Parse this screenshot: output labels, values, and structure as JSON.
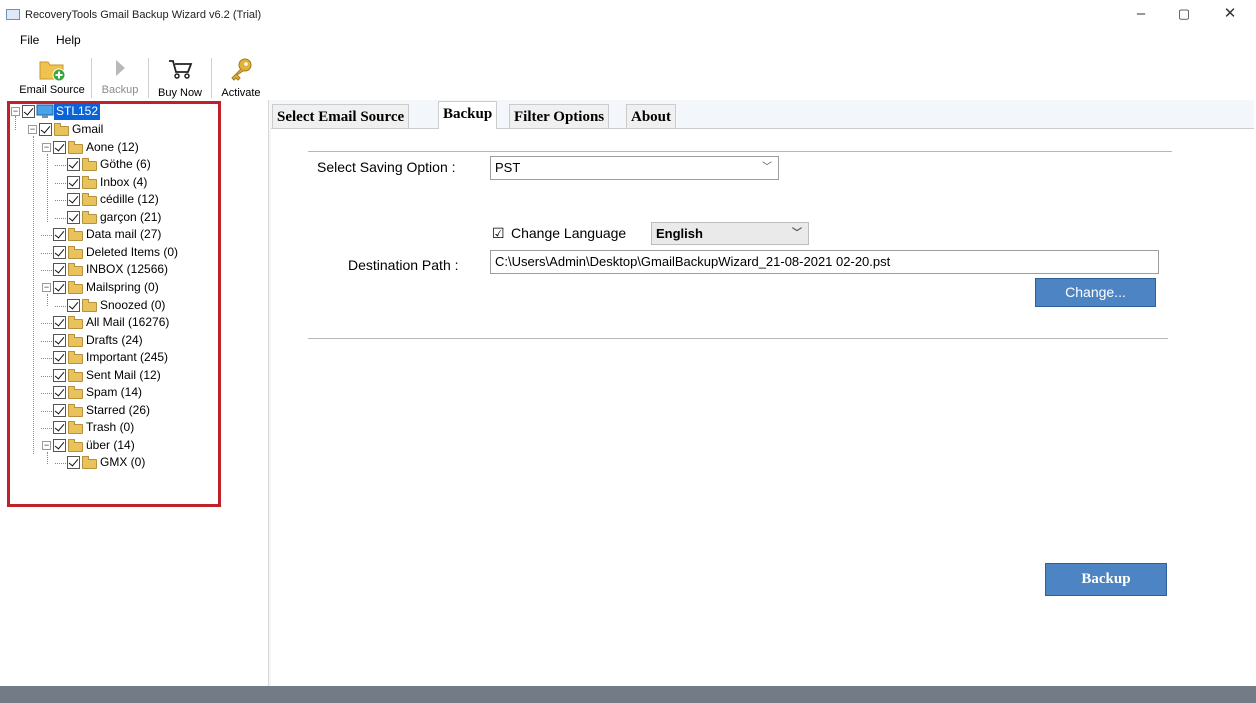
{
  "window": {
    "title": "RecoveryTools Gmail Backup Wizard v6.2 (Trial)",
    "minimize": "–",
    "restore": "▢",
    "close": "✕"
  },
  "menu": [
    "File",
    "Help"
  ],
  "toolbar": {
    "email_source": "Email Source",
    "backup": "Backup",
    "buy_now": "Buy Now",
    "activate": "Activate"
  },
  "tree": {
    "root": "STL152",
    "nodes": [
      {
        "label": "Gmail",
        "depth": 1
      },
      {
        "label": "Aone (12)",
        "depth": 2
      },
      {
        "label": "Göthe (6)",
        "depth": 3
      },
      {
        "label": "Inbox (4)",
        "depth": 3
      },
      {
        "label": "cédille (12)",
        "depth": 3
      },
      {
        "label": "garçon (21)",
        "depth": 3
      },
      {
        "label": "Data mail (27)",
        "depth": 2
      },
      {
        "label": "Deleted Items (0)",
        "depth": 2
      },
      {
        "label": "INBOX (12566)",
        "depth": 2
      },
      {
        "label": "Mailspring (0)",
        "depth": 2
      },
      {
        "label": "Snoozed (0)",
        "depth": 3
      },
      {
        "label": "All Mail (16276)",
        "depth": 2
      },
      {
        "label": "Drafts (24)",
        "depth": 2
      },
      {
        "label": "Important (245)",
        "depth": 2
      },
      {
        "label": "Sent Mail (12)",
        "depth": 2
      },
      {
        "label": "Spam (14)",
        "depth": 2
      },
      {
        "label": "Starred (26)",
        "depth": 2
      },
      {
        "label": "Trash (0)",
        "depth": 2
      },
      {
        "label": "über (14)",
        "depth": 2
      },
      {
        "label": "GMX (0)",
        "depth": 3
      }
    ]
  },
  "tabs": [
    "Select Email Source",
    "Backup",
    "Filter Options",
    "About"
  ],
  "active_tab": "Backup",
  "form": {
    "saving_option_label": "Select Saving Option :",
    "saving_option_value": "PST",
    "change_language_checkbox": "☑",
    "change_language_label": "Change Language",
    "language_value": "English",
    "destination_label": "Destination Path :",
    "destination_value": "C:\\Users\\Admin\\Desktop\\GmailBackupWizard_21-08-2021 02-20.pst",
    "change_button": "Change...",
    "backup_button": "Backup"
  },
  "colors": {
    "highlight_box": "#c0202a",
    "button_blue": "#4d84c4",
    "selection_blue": "#0a64d8",
    "status_bar": "#737b87"
  }
}
